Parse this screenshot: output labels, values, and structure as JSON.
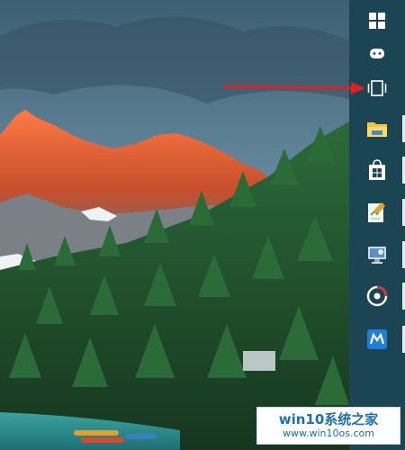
{
  "wallpaper": {
    "description_icon": "mountain-lake-forest-wallpaper",
    "colors": {
      "sky": "#4a6f86",
      "peak": "#e0603a",
      "forest": "#1f4a2a",
      "lake": "#2d8a8a"
    }
  },
  "taskbar": {
    "background": "#1b4552",
    "buttons": [
      {
        "name": "start-button",
        "icon": "windows-logo-icon"
      },
      {
        "name": "cortana-button",
        "icon": "chat-bubble-icon"
      },
      {
        "name": "task-view-button",
        "icon": "task-view-icon"
      },
      {
        "name": "file-explorer-button",
        "icon": "folder-icon"
      },
      {
        "name": "store-button",
        "icon": "store-bag-icon"
      },
      {
        "name": "notepad-app-button",
        "icon": "document-pencil-icon"
      },
      {
        "name": "system-app-button",
        "icon": "computer-monitor-icon"
      },
      {
        "name": "music-app-button",
        "icon": "disc-icon"
      },
      {
        "name": "maxthon-browser-button",
        "icon": "maxthon-m-icon"
      }
    ]
  },
  "annotation": {
    "color": "#e02020",
    "points_to": "task-view-button"
  },
  "watermark": {
    "title": "win10系统之家",
    "url": "www.win10os.com"
  }
}
